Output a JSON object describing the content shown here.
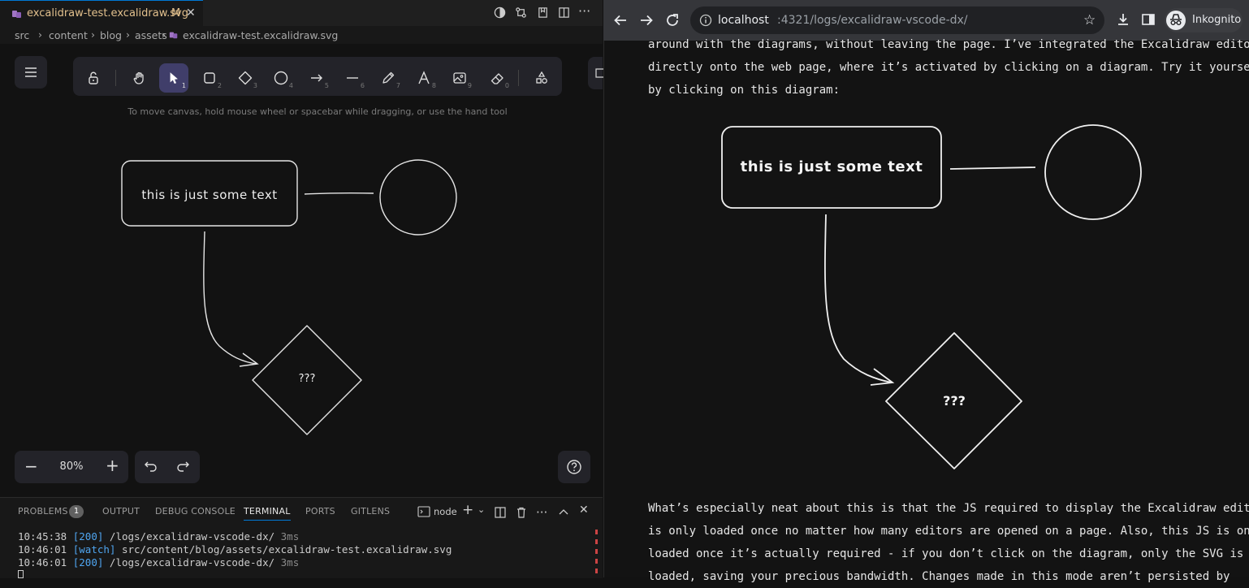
{
  "vscode": {
    "tab": {
      "filename": "excalidraw-test.excalidraw.svg",
      "status": "M"
    },
    "breadcrumb": [
      "src",
      "content",
      "blog",
      "assets",
      "excalidraw-test.excalidraw.svg"
    ],
    "hint": "To move canvas, hold mouse wheel or spacebar while dragging, or use the hand tool",
    "tools": [
      {
        "name": "lock",
        "key": ""
      },
      {
        "name": "hand",
        "key": ""
      },
      {
        "name": "selection",
        "key": "1"
      },
      {
        "name": "rectangle",
        "key": "2"
      },
      {
        "name": "diamond",
        "key": "3"
      },
      {
        "name": "ellipse",
        "key": "4"
      },
      {
        "name": "arrow",
        "key": "5"
      },
      {
        "name": "line",
        "key": "6"
      },
      {
        "name": "draw",
        "key": "7"
      },
      {
        "name": "text",
        "key": "8"
      },
      {
        "name": "image",
        "key": "9"
      },
      {
        "name": "eraser",
        "key": "0"
      },
      {
        "name": "library",
        "key": ""
      }
    ],
    "diagram": {
      "box_text": "this is just some text",
      "diamond_text": "???"
    },
    "zoom": "80%",
    "panel_tabs": [
      "PROBLEMS",
      "OUTPUT",
      "DEBUG CONSOLE",
      "TERMINAL",
      "PORTS",
      "GITLENS"
    ],
    "problems_count": "1",
    "active_panel_tab": "TERMINAL",
    "terminal_name": "node",
    "terminal_lines": [
      {
        "time": "10:45:38",
        "tag": "[200]",
        "text": "/logs/excalidraw-vscode-dx/",
        "dur": "3ms"
      },
      {
        "time": "10:46:01",
        "tag": "[watch]",
        "text": "src/content/blog/assets/excalidraw-test.excalidraw.svg",
        "dur": ""
      },
      {
        "time": "10:46:01",
        "tag": "[200]",
        "text": "/logs/excalidraw-vscode-dx/",
        "dur": "3ms"
      }
    ]
  },
  "browser": {
    "url_host": "localhost",
    "url_rest": ":4321/logs/excalidraw-vscode-dx/",
    "profile": "Inkognito",
    "paragraph1": [
      "around with the diagrams, without leaving the page. I’ve integrated the Excalidraw editor",
      "directly onto the web page, where it’s activated by clicking on a diagram. Try it yourself",
      "by clicking on this diagram:"
    ],
    "diagram": {
      "box_text": "this is just some text",
      "diamond_text": "???"
    },
    "paragraph2": [
      "What’s especially neat about this is that the JS required to display the Excalidraw editor",
      "is only loaded once no matter how many editors are opened on a page. Also, this JS is only",
      "loaded once it’s actually required - if you don’t click on the diagram, only the SVG is",
      "loaded, saving your precious bandwidth. Changes made in this mode aren’t persisted by"
    ]
  },
  "colors": {
    "accent": "#0078d4",
    "selected_tool": "#403e6a",
    "link": "#4fa5f0"
  }
}
